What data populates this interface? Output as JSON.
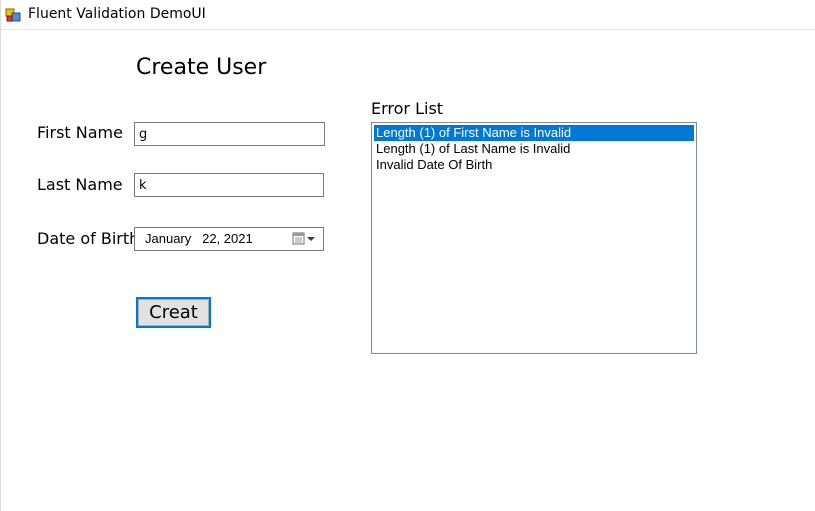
{
  "window": {
    "title": "Fluent Validation DemoUI"
  },
  "form": {
    "heading": "Create User",
    "first_name_label": "First Name",
    "first_name_value": "g",
    "last_name_label": "Last Name",
    "last_name_value": "k",
    "dob_label": "Date of Birth",
    "dob_value": "January   22, 2021",
    "create_button_label": "Creat"
  },
  "errors": {
    "label": "Error List",
    "items": [
      {
        "text": "Length (1) of First Name is Invalid",
        "selected": true
      },
      {
        "text": "Length (1) of Last Name is Invalid",
        "selected": false
      },
      {
        "text": "Invalid Date Of Birth",
        "selected": false
      }
    ]
  },
  "colors": {
    "selection": "#0078d7",
    "button_focus_border": "#0078d7",
    "button_face": "#e1e1e1"
  },
  "icons": {
    "app": "winforms-app-icon",
    "calendar": "calendar-dropdown-icon"
  }
}
